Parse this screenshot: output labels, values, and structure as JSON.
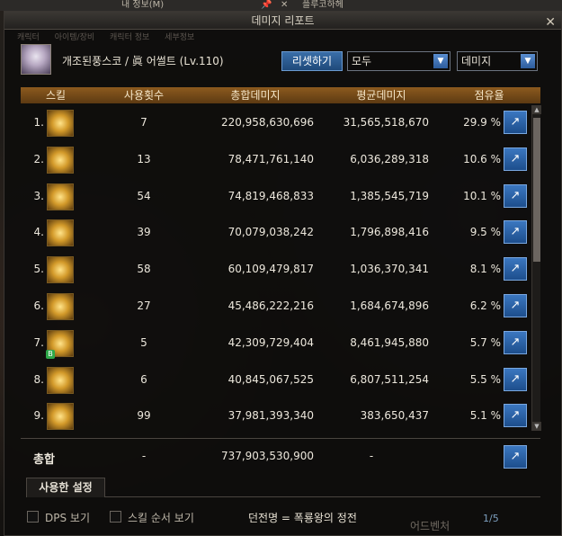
{
  "background": {
    "top_left_text": "내 정보(M)",
    "top_right_text": "플루코하헤"
  },
  "window": {
    "title": "데미지 리포트",
    "ghost_tabs": [
      "캐릭터",
      "아이템/장비",
      "캐릭터 정보",
      "세부정보"
    ]
  },
  "character": {
    "name": "개조된풍스코 / 眞 어썰트 (Lv.110)"
  },
  "controls": {
    "reset_label": "리셋하기",
    "filter_value": "모두",
    "metric_value": "데미지"
  },
  "table": {
    "headers": [
      "스킬",
      "사용횟수",
      "총합데미지",
      "평균데미지",
      "점유율"
    ],
    "rows": [
      {
        "rank": "1.",
        "count": "7",
        "total": "220,958,630,696",
        "avg": "31,565,518,670",
        "share": "29.9  %"
      },
      {
        "rank": "2.",
        "count": "13",
        "total": "78,471,761,140",
        "avg": "6,036,289,318",
        "share": "10.6  %"
      },
      {
        "rank": "3.",
        "count": "54",
        "total": "74,819,468,833",
        "avg": "1,385,545,719",
        "share": "10.1  %"
      },
      {
        "rank": "4.",
        "count": "39",
        "total": "70,079,038,242",
        "avg": "1,796,898,416",
        "share": "9.5  %"
      },
      {
        "rank": "5.",
        "count": "58",
        "total": "60,109,479,817",
        "avg": "1,036,370,341",
        "share": "8.1  %"
      },
      {
        "rank": "6.",
        "count": "27",
        "total": "45,486,222,216",
        "avg": "1,684,674,896",
        "share": "6.2  %"
      },
      {
        "rank": "7.",
        "count": "5",
        "total": "42,309,729,404",
        "avg": "8,461,945,880",
        "share": "5.7  %"
      },
      {
        "rank": "8.",
        "count": "6",
        "total": "40,845,067,525",
        "avg": "6,807,511,254",
        "share": "5.5  %"
      },
      {
        "rank": "9.",
        "count": "99",
        "total": "37,981,393,340",
        "avg": "383,650,437",
        "share": "5.1  %"
      }
    ]
  },
  "summary": {
    "label": "총합",
    "count": "-",
    "total": "737,903,530,900",
    "avg": "-"
  },
  "settings": {
    "tab_label": "사용한 설정"
  },
  "footer": {
    "dps_label": "DPS 보기",
    "order_label": "스킬 순서 보기",
    "dungeon": "던전명 = 폭룡왕의 정전",
    "page": "1/5",
    "ghost_text": "어드벤처"
  },
  "icons": {
    "close": "close-icon",
    "share": "share-icon",
    "dropdown": "chevron-down-icon"
  },
  "colors": {
    "header": "#8c5a1e",
    "button": "#2d5c9c"
  }
}
